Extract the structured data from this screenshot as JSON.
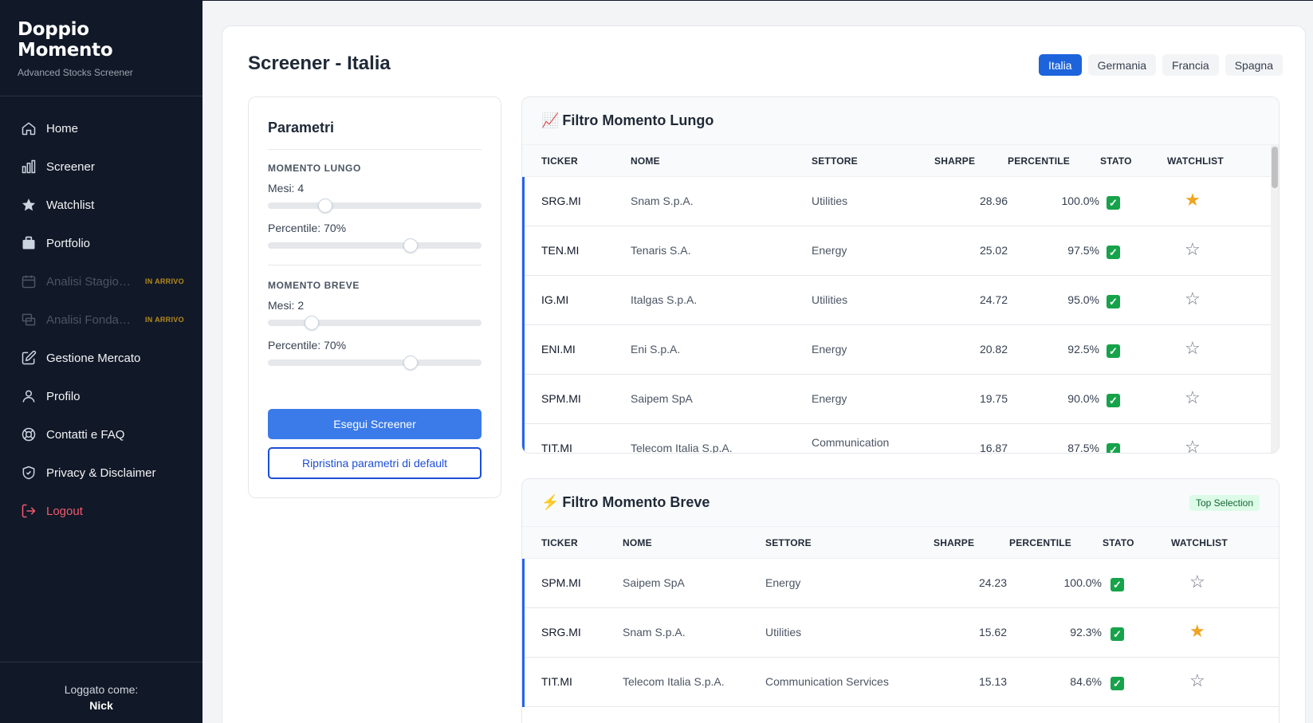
{
  "brand": {
    "title": "Doppio Momento",
    "subtitle": "Advanced Stocks Screener"
  },
  "nav": [
    {
      "label": "Home",
      "icon": "home-icon"
    },
    {
      "label": "Screener",
      "icon": "bar-chart-icon"
    },
    {
      "label": "Watchlist",
      "icon": "star-icon"
    },
    {
      "label": "Portfolio",
      "icon": "briefcase-icon"
    },
    {
      "label": "Analisi Stagionalità",
      "icon": "calendar-icon",
      "badge": "IN ARRIVO",
      "disabled": true
    },
    {
      "label": "Analisi Fondamentale",
      "icon": "layers-icon",
      "badge": "IN ARRIVO",
      "disabled": true
    },
    {
      "label": "Gestione Mercato",
      "icon": "edit-icon"
    },
    {
      "label": "Profilo",
      "icon": "user-icon"
    },
    {
      "label": "Contatti e FAQ",
      "icon": "lifebuoy-icon"
    },
    {
      "label": "Privacy & Disclaimer",
      "icon": "shield-icon"
    },
    {
      "label": "Logout",
      "icon": "logout-icon"
    }
  ],
  "footer": {
    "logged_as": "Loggato come:",
    "username": "Nick"
  },
  "page": {
    "title": "Screener - Italia"
  },
  "country_tabs": [
    {
      "label": "Italia",
      "active": true
    },
    {
      "label": "Germania"
    },
    {
      "label": "Francia"
    },
    {
      "label": "Spagna"
    }
  ],
  "params": {
    "title": "Parametri",
    "long": {
      "section": "MOMENTO LUNGO",
      "months_label": "Mesi: 4",
      "months_value": 4,
      "percentile_label": "Percentile: 70%",
      "percentile_value": 70
    },
    "short": {
      "section": "MOMENTO BREVE",
      "months_label": "Mesi: 2",
      "months_value": 2,
      "percentile_label": "Percentile: 70%",
      "percentile_value": 70
    },
    "run_button": "Esegui Screener",
    "reset_button": "Ripristina parametri di default"
  },
  "colors": {
    "accent": "#1d63dc",
    "star_on": "#f0a41f",
    "check": "#16a34a",
    "logout": "#f05b6e"
  },
  "long_table": {
    "icon": "📈",
    "title": "Filtro Momento Lungo",
    "columns": [
      "TICKER",
      "NOME",
      "SETTORE",
      "SHARPE",
      "PERCENTILE",
      "STATO",
      "WATCHLIST"
    ],
    "rows": [
      {
        "ticker": "SRG.MI",
        "name": "Snam S.p.A.",
        "sector": "Utilities",
        "sharpe": "28.96",
        "percentile": "100.0%",
        "status": "✓",
        "watch": "★",
        "starred": true
      },
      {
        "ticker": "TEN.MI",
        "name": "Tenaris S.A.",
        "sector": "Energy",
        "sharpe": "25.02",
        "percentile": "97.5%",
        "status": "✓",
        "watch": "☆",
        "starred": false
      },
      {
        "ticker": "IG.MI",
        "name": "Italgas S.p.A.",
        "sector": "Utilities",
        "sharpe": "24.72",
        "percentile": "95.0%",
        "status": "✓",
        "watch": "☆",
        "starred": false
      },
      {
        "ticker": "ENI.MI",
        "name": "Eni S.p.A.",
        "sector": "Energy",
        "sharpe": "20.82",
        "percentile": "92.5%",
        "status": "✓",
        "watch": "☆",
        "starred": false
      },
      {
        "ticker": "SPM.MI",
        "name": "Saipem SpA",
        "sector": "Energy",
        "sharpe": "19.75",
        "percentile": "90.0%",
        "status": "✓",
        "watch": "☆",
        "starred": false
      },
      {
        "ticker": "TIT.MI",
        "name": "Telecom Italia S.p.A.",
        "sector": "Communication",
        "sharpe": "16.87",
        "percentile": "87.5%",
        "status": "✓",
        "watch": "☆",
        "starred": false
      }
    ]
  },
  "short_table": {
    "icon": "⚡",
    "title": "Filtro Momento Breve",
    "badge": "Top Selection",
    "columns": [
      "TICKER",
      "NOME",
      "SETTORE",
      "SHARPE",
      "PERCENTILE",
      "STATO",
      "WATCHLIST"
    ],
    "rows": [
      {
        "ticker": "SPM.MI",
        "name": "Saipem SpA",
        "sector": "Energy",
        "sharpe": "24.23",
        "percentile": "100.0%",
        "status": "✓",
        "watch": "☆",
        "starred": false
      },
      {
        "ticker": "SRG.MI",
        "name": "Snam S.p.A.",
        "sector": "Utilities",
        "sharpe": "15.62",
        "percentile": "92.3%",
        "status": "✓",
        "watch": "★",
        "starred": true
      },
      {
        "ticker": "TIT.MI",
        "name": "Telecom Italia S.p.A.",
        "sector": "Communication Services",
        "sharpe": "15.13",
        "percentile": "84.6%",
        "status": "✓",
        "watch": "☆",
        "starred": false
      }
    ]
  }
}
